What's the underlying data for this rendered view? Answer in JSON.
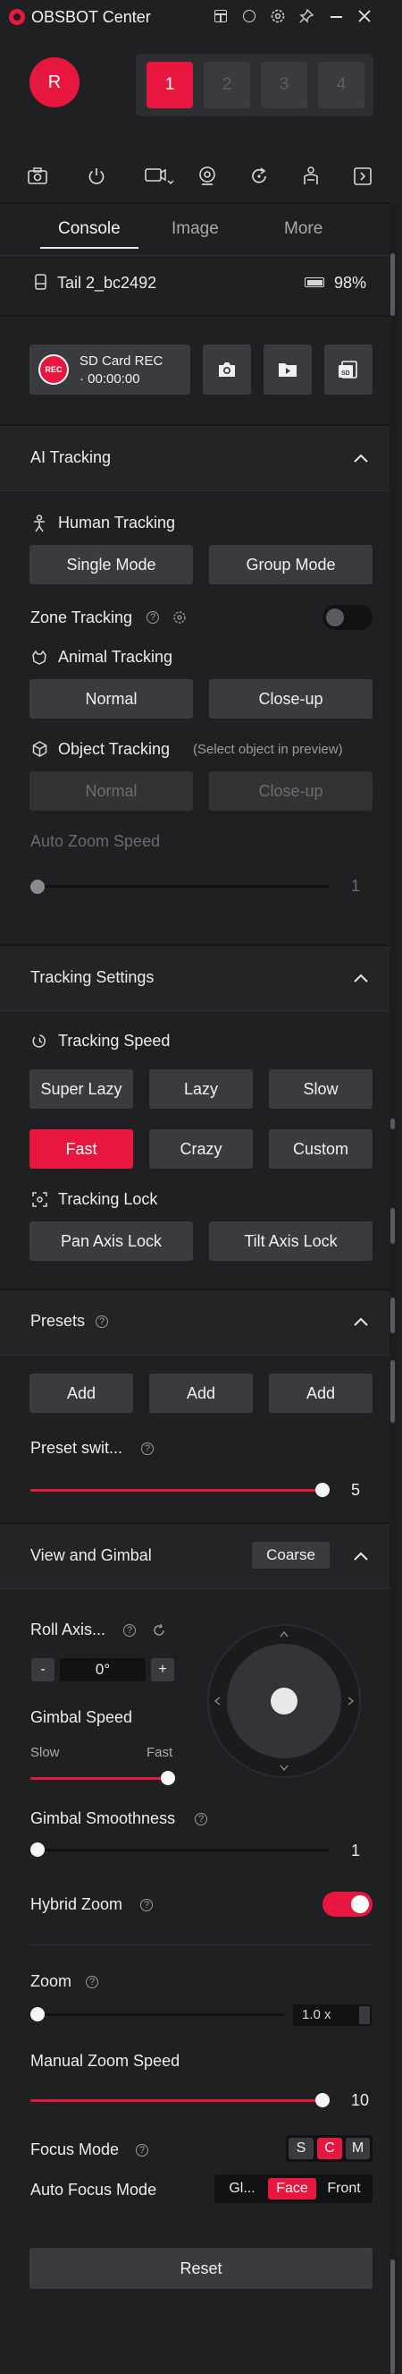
{
  "app": {
    "title": "OBSBOT Center",
    "avatar_letter": "R"
  },
  "devices": {
    "slots": [
      "1",
      "2",
      "3",
      "4"
    ],
    "active": "1"
  },
  "toolbar": {
    "icons": [
      "camera-snapshot-icon",
      "power-icon",
      "video-settings-icon",
      "webcam-icon",
      "rotate-icon",
      "presenter-icon",
      "collapse-panel-icon"
    ]
  },
  "tabs": {
    "console": "Console",
    "image": "Image",
    "more": "More"
  },
  "device": {
    "name": "Tail 2_bc2492",
    "battery": "98%"
  },
  "record": {
    "badge": "REC",
    "title": "SD Card REC",
    "time": "· 00:00:00"
  },
  "ai_tracking": {
    "title": "AI Tracking",
    "human": "Human Tracking",
    "single_mode": "Single Mode",
    "group_mode": "Group Mode",
    "zone": "Zone Tracking",
    "animal": "Animal Tracking",
    "animal_normal": "Normal",
    "animal_closeup": "Close-up",
    "object": "Object Tracking",
    "object_hint": "(Select object in preview)",
    "object_normal": "Normal",
    "object_closeup": "Close-up",
    "auto_zoom_speed": "Auto Zoom Speed",
    "auto_zoom_value": "1"
  },
  "tracking_settings": {
    "title": "Tracking Settings",
    "speed_label": "Tracking Speed",
    "speeds": [
      "Super Lazy",
      "Lazy",
      "Slow",
      "Fast",
      "Crazy",
      "Custom"
    ],
    "active_speed": "Fast",
    "lock_label": "Tracking Lock",
    "pan_lock": "Pan Axis Lock",
    "tilt_lock": "Tilt Axis Lock"
  },
  "presets": {
    "title": "Presets",
    "add": [
      "Add",
      "Add",
      "Add"
    ],
    "switch_label": "Preset swit...",
    "switch_value": "5",
    "switch_fraction": 1.0
  },
  "gimbal": {
    "title": "View and Gimbal",
    "mode": "Coarse",
    "roll_label": "Roll Axis...",
    "roll_minus": "-",
    "roll_value": "0°",
    "roll_plus": "+",
    "speed_label": "Gimbal Speed",
    "slow": "Slow",
    "fast": "Fast",
    "speed_fraction": 1.0,
    "smoothness_label": "Gimbal Smoothness",
    "smoothness_value": "1",
    "hybrid_zoom_label": "Hybrid Zoom",
    "hybrid_zoom_on": true
  },
  "zoom": {
    "label": "Zoom",
    "value": "1.0 x",
    "manual_label": "Manual Zoom Speed",
    "manual_value": "10"
  },
  "focus": {
    "mode_label": "Focus Mode",
    "modes": [
      "S",
      "C",
      "M"
    ],
    "active_mode": "C",
    "auto_label": "Auto Focus Mode",
    "auto_modes": [
      "Gl...",
      "Face",
      "Front"
    ],
    "active_auto": "Face"
  },
  "reset": "Reset",
  "colors": {
    "accent": "#e8173f",
    "bg": "#1f2022",
    "panel": "#252628",
    "button": "#3a3b3e"
  }
}
